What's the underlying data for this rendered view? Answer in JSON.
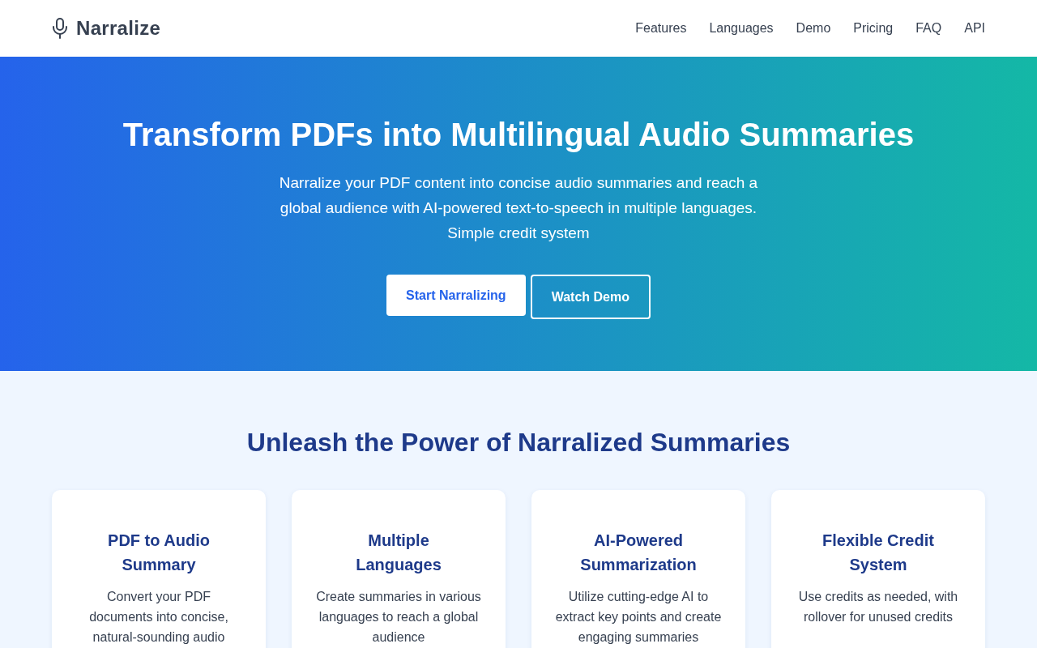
{
  "header": {
    "brand": "Narralize",
    "nav": [
      "Features",
      "Languages",
      "Demo",
      "Pricing",
      "FAQ",
      "API"
    ]
  },
  "hero": {
    "title": "Transform PDFs into Multilingual Audio Summaries",
    "subtitle": "Narralize your PDF content into concise audio summaries and reach a global audience with AI-powered text-to-speech in multiple languages. Simple credit system",
    "buttons": [
      {
        "label": "Start Narralizing",
        "kind": "primary"
      },
      {
        "label": "Watch Demo",
        "kind": "outline"
      }
    ]
  },
  "features": {
    "title": "Unleash the Power of Narralized Summaries",
    "cards": [
      {
        "title": "PDF to Audio Summary",
        "description": "Convert your PDF documents into concise, natural-sounding audio"
      },
      {
        "title": "Multiple Languages",
        "description": "Create summaries in various languages to reach a global audience"
      },
      {
        "title": "AI-Powered Summarization",
        "description": "Utilize cutting-edge AI to extract key points and create engaging summaries"
      },
      {
        "title": "Flexible Credit System",
        "description": "Use credits as needed, with rollover for unused credits"
      }
    ]
  }
}
